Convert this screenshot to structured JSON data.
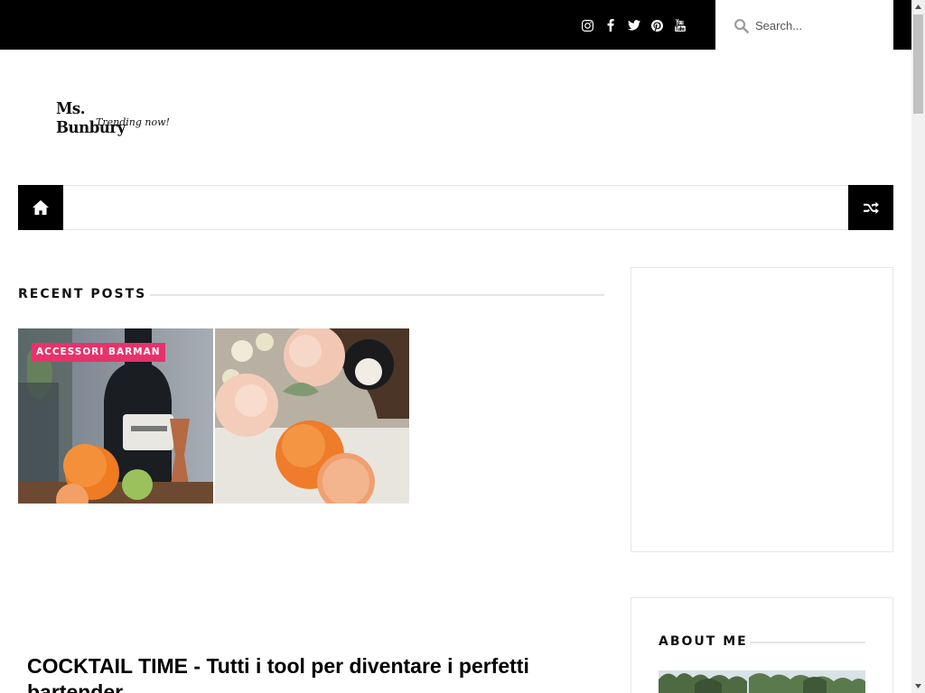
{
  "topbar": {
    "socials": [
      {
        "name": "instagram-icon"
      },
      {
        "name": "facebook-icon"
      },
      {
        "name": "twitter-icon"
      },
      {
        "name": "pinterest-icon"
      },
      {
        "name": "youtube-icon"
      }
    ],
    "search": {
      "placeholder": "Search..."
    }
  },
  "logo": {
    "title": "Ms. Bunbury",
    "tagline": "Trending now!"
  },
  "nav": {
    "home_icon": "home-icon",
    "random_icon": "shuffle-icon"
  },
  "recent_posts": {
    "heading": "RECENT POSTS",
    "category_badge": "ACCESSORI BARMAN",
    "post_title": "COCKTAIL TIME - Tutti i tool per diventare i perfetti bartender"
  },
  "sidebar": {
    "about_heading": "ABOUT ME"
  },
  "colors": {
    "topbar_bg": "#000000",
    "badge_bg": "#e8326b",
    "nav_button_bg": "#000000"
  }
}
